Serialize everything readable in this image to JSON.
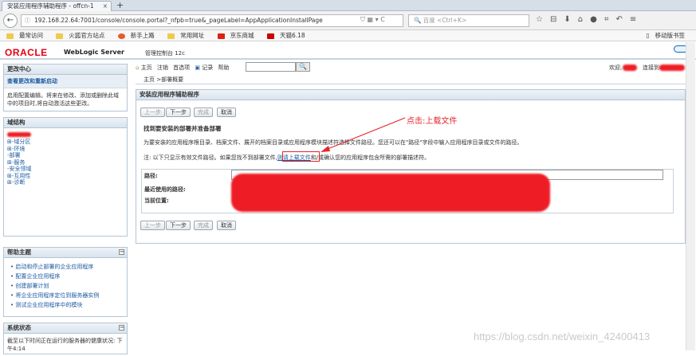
{
  "browser": {
    "tab_title": "安装应用程序辅助程序 - offcn-1",
    "tab_close": "×",
    "new_tab": "+",
    "url": "192.168.22.64:7001/console/console.portal?_nfpb=true&_pageLabel=AppApplicationInstallPage",
    "search_placeholder": "百度 <Ctrl+K>",
    "bookmarks": [
      "最常访问",
      "火狐官方站点",
      "新手上路",
      "常用网址",
      "京东商城",
      "天猫6.18"
    ],
    "mobile_bookmarks": "移动版书签"
  },
  "header": {
    "oracle": "ORACLE",
    "product": "WebLogic Server",
    "subtitle": "管理控制台 12c"
  },
  "toolbar": {
    "home": "主页",
    "logout": "注销",
    "prefs": "首选项",
    "record": "记录",
    "help": "帮助",
    "welcome": "欢迎,",
    "connected": "连接到:"
  },
  "breadcrumb": "主页 >部署概要",
  "change_center": {
    "title": "更改中心",
    "link": "查看更改和重新启动",
    "desc": "启用配置编辑。将来在修改、添加或删除此域中的项目时,将自动激活这些更改。"
  },
  "domain_structure": {
    "title": "域结构",
    "items": [
      "⊞-域分区",
      "⊞-环境",
      "  -部署",
      "⊞-服务",
      "  -安全领域",
      "⊞-互用性",
      "⊞-诊断"
    ]
  },
  "help_topics": {
    "title": "帮助主题",
    "items": [
      "启动和停止部署的企业应用程序",
      "配置企业应用程序",
      "创建部署计划",
      "将企业应用程序定位到服务器实例",
      "测试企业应用程序中的模块"
    ]
  },
  "system_status": {
    "title": "系统状态",
    "desc": "截至以下时间正在运行的服务器的健康状况: 下午4:14"
  },
  "main": {
    "panel_title": "安装应用程序辅助程序",
    "btn_prev": "上一步",
    "btn_next": "下一步",
    "btn_finish": "完成",
    "btn_cancel": "取消",
    "section_title": "找到要安装的部署并准备部署",
    "desc": "为要安装的应用程序根目录、档案文件、展开的档案目录或应用程序模块描述符选择文件路径。您还可以在\"路径\"字段中输入应用程序目录或文件的路径。",
    "note_prefix": "注: 以下只显示有效文件路径。如果您找不到部署文件,",
    "note_link": "则请上载文件",
    "note_suffix": "和/或确认您的应用程序包含所需的部署描述符。",
    "label_path": "路径:",
    "label_recent": "最近使用的路径:",
    "label_current": "当前位置:"
  },
  "annotation": {
    "text": "点击:上载文件"
  },
  "watermark": "https://blog.csdn.net/weixin_42400413"
}
